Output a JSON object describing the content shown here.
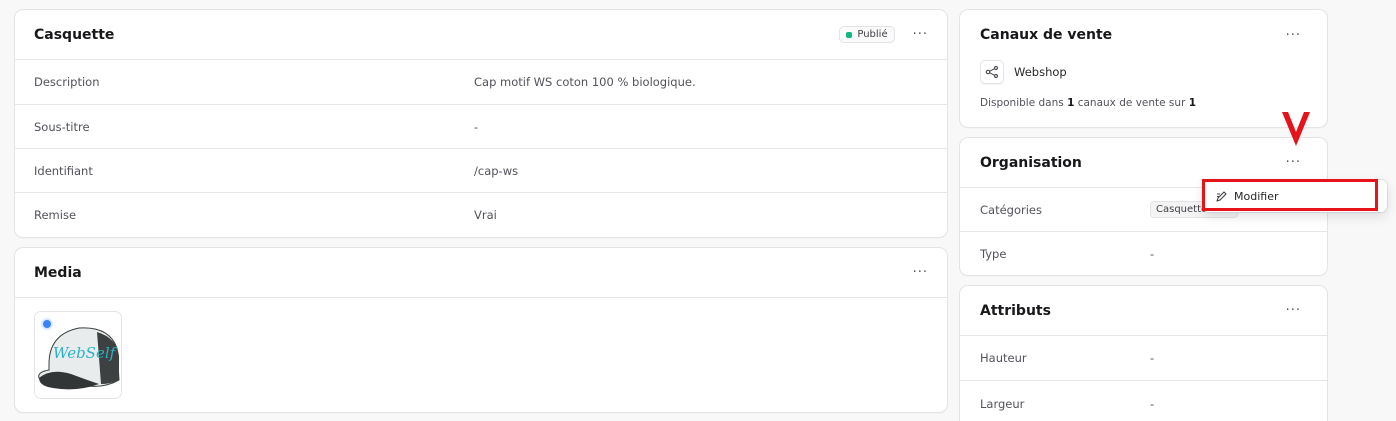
{
  "product": {
    "title": "Casquette",
    "status_badge": "Publié",
    "fields": [
      {
        "label": "Description",
        "value": "Cap motif WS coton 100 % biologique."
      },
      {
        "label": "Sous-titre",
        "value": "-"
      },
      {
        "label": "Identifiant",
        "value": "/cap-ws"
      },
      {
        "label": "Remise",
        "value": "Vrai"
      }
    ]
  },
  "media": {
    "title": "Media",
    "thumbnail_icon": "cap-image"
  },
  "sales_channels": {
    "title": "Canaux de vente",
    "channel_name": "Webshop",
    "channel_icon": "share-nodes-icon",
    "availability_prefix": "Disponible dans ",
    "available_count": "1",
    "availability_middle": " canaux de vente sur ",
    "total_count": "1"
  },
  "organisation": {
    "title": "Organisation",
    "categories_label": "Catégories",
    "categories_chip": "Casquettes WS",
    "type_label": "Type",
    "type_value": "-"
  },
  "attributes": {
    "title": "Attributs",
    "rows": [
      {
        "label": "Hauteur",
        "value": "-"
      },
      {
        "label": "Largeur",
        "value": "-"
      }
    ]
  },
  "dropdown": {
    "edit_label": "Modifier",
    "edit_icon": "pencil-square-icon"
  },
  "colors": {
    "annotation": "#e4141a",
    "status_green": "#10b981"
  }
}
